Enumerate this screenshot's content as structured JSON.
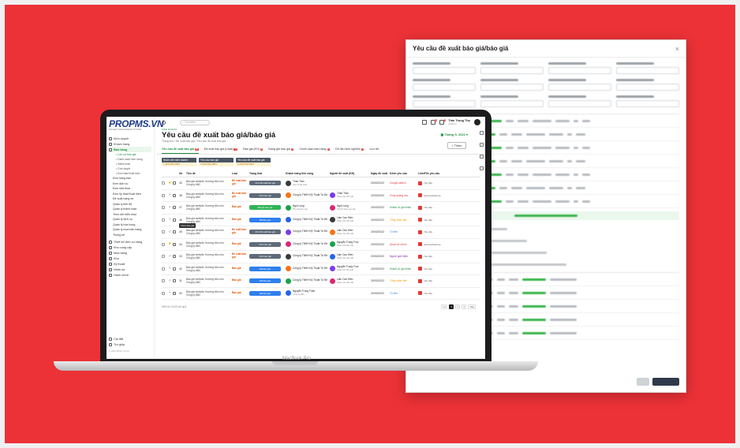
{
  "modal": {
    "title": "Yêu cầu đề xuất báo giá/báo giá",
    "close": "×"
  },
  "laptop": {
    "model": "MacBook Pro"
  },
  "app": {
    "logo": "PROPMS.VN",
    "logo_sub": "PROJECT MANAGEMENT SYSTEM",
    "search_placeholder": "Tìm kiếm",
    "user": {
      "name": "Trần Trung Thọ",
      "role": "Quản lý"
    },
    "badges": {
      "notifications": "10",
      "messages": "9"
    },
    "sidebar": {
      "items": [
        {
          "label": "Kinh doanh"
        },
        {
          "label": "Khách hàng"
        },
        {
          "label": "Báo hàng"
        }
      ],
      "subitems": [
        "Lịch sử báo giá",
        "Danh sách đơn hàng",
        "Sales lead",
        "Chờ duyệt",
        "Đơn bán/Xuất hiện"
      ],
      "plain": [
        "Đơn hàng bán",
        "Đơn dịch vụ",
        "Đơn nhà thuê",
        "Đơn ủy thác/Xuất hiện",
        "Đề xuất hàng về",
        "Quản lý tiến độ",
        "Quản lý thanh toán",
        "Theo dõi triển khai",
        "Quản lý dịch vụ",
        "Quản lý hóa hồng",
        "Quản lý mua bán hàng",
        "Thống kê"
      ],
      "groups": [
        {
          "label": "Thiết kế dịch vụ hàng"
        },
        {
          "label": "Kho cung cấp"
        },
        {
          "label": "Mua hàng"
        },
        {
          "label": "Kho"
        },
        {
          "label": "Kỹ thuật"
        },
        {
          "label": "Nhân sự"
        },
        {
          "label": "Hành chính"
        }
      ],
      "bottom": [
        "Cài đặt",
        "Trợ giúp"
      ],
      "copyright": "© 2022 ESTH Group"
    },
    "crumb_small": "KINH DOANH",
    "page_title": "Yêu cầu đề xuất báo giá/báo giá",
    "breadcrumb": "Trang chủ  /  Đề xuất báo giá  /  Yêu cầu đề xuất báo giá",
    "date": "Tháng 9, 2022",
    "add_button": "+ Thêm",
    "tabs": [
      {
        "label": "Yêu cầu đề xuất báo giá",
        "count": "10"
      },
      {
        "label": "Đề xuất báo giá (Lead)",
        "count": "12"
      },
      {
        "label": "Báo giá (KH)",
        "count": "8"
      },
      {
        "label": "Đang gửi báo giá",
        "count": "3"
      },
      {
        "label": "Chính sách bán hàng",
        "count": "6"
      },
      {
        "label": "Dữ liệu kinh nghiệm",
        "count": "4"
      },
      {
        "label": "Lưu trữ",
        "count": ""
      }
    ],
    "filters": [
      {
        "head": "Nhân viên kinh doanh",
        "value": "1,000,000,0004"
      },
      {
        "head": "Yêu cầu báo giá",
        "value": "1,000,000,0004"
      },
      {
        "head": "Yêu cầu đề xuất báo giá",
        "value": "1,000,000,0004"
      }
    ],
    "table": {
      "headers": [
        "",
        "Số",
        "Tiêu đề",
        "Loại",
        "Trạng thái",
        "Khách hàng liên cùng",
        "Người đề xuất (KH)",
        "Ngày đề xuất",
        "Kênh yêu cầu",
        "Link/File yêu cầu"
      ],
      "rows": [
        {
          "no": "40",
          "title": "Báo giá website, thương hiệu cho Công ty ABC",
          "type": "Đề xuất báo giá",
          "status": "Chờ đề xuất báo giá",
          "status_color": "gray",
          "cust": "Thảo Trần",
          "cust_sub": "Liên hệ đề xuất",
          "ppl": "",
          "ppl_sub": "",
          "date": "20/02/2022",
          "src": "Google search",
          "src_color": "#e53935",
          "link": "Yêu cầu",
          "star": true
        },
        {
          "no": "38",
          "title": "Báo giá website, thương hiệu cho Công ty ABC",
          "type": "Đề xuất báo giá",
          "status": "Chờ báo giá",
          "status_color": "gray",
          "cust": "Công ty TNHH Kỹ Thuật Tự Đề",
          "cust_sub": "",
          "ppl": "Thảo Trần",
          "ppl_sub": "Nhân viên đề xuất",
          "date": "20/02/2022",
          "src": "Chạy quảng cáo",
          "src_color": "#e53935",
          "link": "www.website.be",
          "star": false
        },
        {
          "no": "37",
          "title": "Báo giá website, thương hiệu cho Công ty ABC",
          "type": "Báo giá",
          "status": "Đã gửi báo giá",
          "status_color": "green",
          "cust": "Ngọt Long",
          "cust_sub": "Phó chuyên viên",
          "ppl": "Ngọt Long",
          "ppl_sub": "Khách hàng cao cấp",
          "date": "20/02/2022",
          "src": "Khách cũ giới thiệu",
          "src_color": "#1e8e3e",
          "link": "Yêu cầu",
          "star": false
        },
        {
          "no": "36",
          "title": "Báo giá website, thương hiệu cho Công ty ABC",
          "type": "Báo giá",
          "status": "Đã báo giá",
          "status_color": "blue",
          "cust": "Công ty TNHH Kỹ Thuật Tự Đề",
          "cust_sub": "",
          "ppl": "Lâm Cao Hiền",
          "ppl_sub": "Nhân viên đề xuất",
          "date": "20/02/2022",
          "src": "Tổng nhân viên",
          "src_color": "#f29900",
          "link": "Yêu cầu",
          "star": false
        },
        {
          "no": "35",
          "title": "Báo giá website, thương hiệu cho Công ty ABC",
          "type": "Đề xuất báo giá",
          "status": "Chờ đề xuất báo giá",
          "status_color": "gray",
          "cust": "Công ty TNHH Kỹ Thuật Tự Đề",
          "cust_sub": "",
          "ppl": "Lâm Cao Hiền",
          "ppl_sub": "Nhân viên đề xuất",
          "date": "20/02/2022",
          "src": "Tự liên",
          "src_color": "#2f80ed",
          "link": "Yêu cầu",
          "star": false
        },
        {
          "no": "34",
          "title": "Báo giá website, thương hiệu cho Công ty ABC",
          "type": "Báo giá",
          "status": "Chờ báo giá",
          "status_color": "gray",
          "cust": "Công ty TNHH Kỹ Thuật Tự Đề",
          "cust_sub": "",
          "ppl": "Nguyễn Trung Trực",
          "ppl_sub": "Nhân viên đề xuất",
          "date": "20/02/2022",
          "src": "Quan hệ xã hội",
          "src_color": "#e53935",
          "link": "www.website.be",
          "star": true
        },
        {
          "no": "33",
          "title": "Báo giá website, thương hiệu cho Công ty ABC",
          "type": "Đề xuất báo giá",
          "status": "Chờ báo giá",
          "status_color": "gray",
          "cust": "Công ty TNHH Kỹ Thuật Tự Đề",
          "cust_sub": "",
          "ppl": "Lâm Cao Hiền",
          "ppl_sub": "Nhân viên đề xuất",
          "date": "20/02/2022",
          "src": "Người giới thiệu",
          "src_color": "#8e24aa",
          "link": "Yêu cầu",
          "star": false
        },
        {
          "no": "32",
          "title": "Báo giá website, thương hiệu cho Công ty ABC",
          "type": "Báo giá",
          "status": "Đã báo giá",
          "status_color": "blue",
          "cust": "Công ty TNHH Kỹ Thuật Tự Đề",
          "cust_sub": "",
          "ppl": "Nguyễn Trung Trực",
          "ppl_sub": "Nhân viên đề xuất",
          "date": "20/02/2022",
          "src": "Khách cũ giới thiệu",
          "src_color": "#1e8e3e",
          "link": "Yêu cầu",
          "star": false
        },
        {
          "no": "31",
          "title": "Báo giá website, thương hiệu cho Công ty ABC",
          "type": "Báo giá",
          "status": "Đã báo giá",
          "status_color": "blue",
          "cust": "Công ty TNHH Kỹ Thuật Tự Đề",
          "cust_sub": "",
          "ppl": "Lâm Cao Hiền",
          "ppl_sub": "Nhân viên đề xuất",
          "date": "20/02/2022",
          "src": "Tổng nhân viên",
          "src_color": "#f29900",
          "link": "Yêu cầu",
          "star": false
        },
        {
          "no": "30",
          "title": "Báo giá website, thương hiệu cho Công ty ABC",
          "type": "Báo giá",
          "status": "Đã báo giá",
          "status_color": "blue",
          "cust": "Nguyễn Trung Thảo",
          "cust_sub": "Công ty ABC",
          "ppl": "",
          "ppl_sub": "",
          "date": "20/02/2022",
          "src": "Tự liên",
          "src_color": "#2f80ed",
          "link": "Yêu cầu",
          "star": false
        }
      ]
    },
    "footer_text": "Hiển thị 10/40 kết quả",
    "pager": [
      "Lùi",
      "1",
      "2",
      "3",
      "Tiếp"
    ],
    "tooltip": "Chưa báo giá"
  }
}
